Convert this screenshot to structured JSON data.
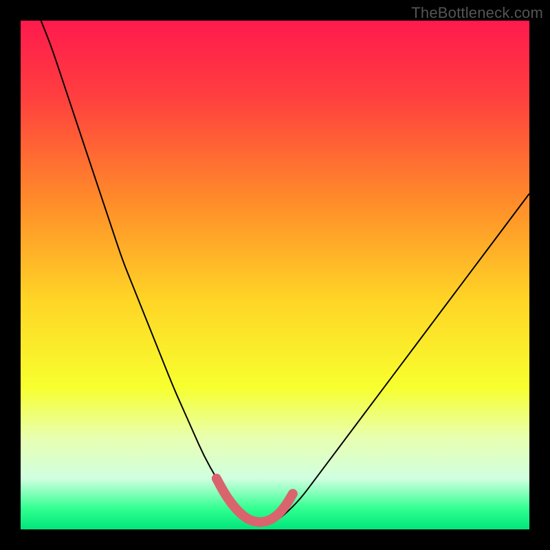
{
  "watermark": "TheBottleneck.com",
  "chart_data": {
    "type": "line",
    "title": "",
    "xlabel": "",
    "ylabel": "",
    "xlim": [
      0,
      100
    ],
    "ylim": [
      0,
      100
    ],
    "background_gradient": {
      "stops": [
        {
          "offset": 0.0,
          "color": "#ff1a4d"
        },
        {
          "offset": 0.15,
          "color": "#ff3f3f"
        },
        {
          "offset": 0.35,
          "color": "#ff8a2a"
        },
        {
          "offset": 0.55,
          "color": "#ffd526"
        },
        {
          "offset": 0.72,
          "color": "#f7ff2e"
        },
        {
          "offset": 0.82,
          "color": "#e8ffb0"
        },
        {
          "offset": 0.9,
          "color": "#d0ffe0"
        },
        {
          "offset": 0.96,
          "color": "#30ff90"
        },
        {
          "offset": 1.0,
          "color": "#00e57a"
        }
      ]
    },
    "series": [
      {
        "name": "bottleneck-curve",
        "color": "#000000",
        "width": 2,
        "x": [
          4,
          6,
          8,
          10,
          12,
          14,
          16,
          18,
          20,
          22,
          24,
          26,
          28,
          30,
          32,
          34,
          36,
          38.5,
          41,
          44,
          47,
          48.5,
          50,
          52,
          55,
          58,
          61,
          64,
          67,
          70,
          73,
          76,
          79,
          82,
          85,
          88,
          91,
          94,
          97,
          100
        ],
        "y": [
          100,
          95,
          89,
          83,
          77,
          71,
          65,
          59,
          53,
          48,
          43,
          38,
          33,
          28,
          23.5,
          19,
          14.5,
          10,
          6,
          3,
          1.5,
          1.3,
          1.5,
          3,
          6,
          10,
          14,
          18,
          22,
          26,
          30,
          34,
          38,
          42,
          46,
          50,
          54,
          58,
          62,
          66
        ]
      },
      {
        "name": "valley-highlight",
        "color": "#d9646e",
        "width": 14,
        "linecap": "round",
        "x": [
          38.5,
          40,
          41.5,
          43,
          44.5,
          46,
          47.5,
          49,
          50.5,
          52,
          53.5
        ],
        "y": [
          10,
          7.2,
          5,
          3.3,
          2.1,
          1.5,
          1.4,
          1.8,
          2.8,
          4.5,
          7
        ]
      }
    ]
  }
}
